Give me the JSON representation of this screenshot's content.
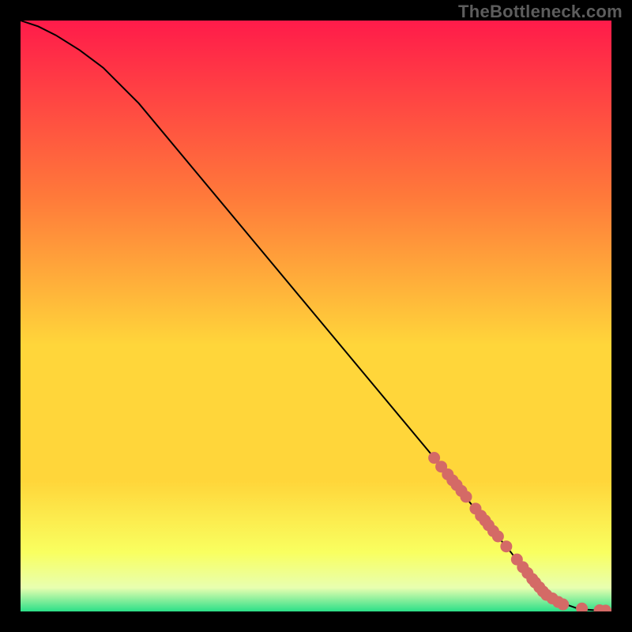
{
  "watermark": "TheBottleneck.com",
  "colors": {
    "bg_black": "#000000",
    "gradient_top": "#ff1b4a",
    "gradient_mid_upper": "#ff7a3a",
    "gradient_mid": "#ffd63a",
    "gradient_mid_lower": "#f9ff60",
    "gradient_low": "#e8ffb0",
    "gradient_bottom": "#2bdf88",
    "curve": "#000000",
    "marker": "#d46a66",
    "watermark": "#5d5d5d"
  },
  "chart_data": {
    "type": "line",
    "title": "",
    "xlabel": "",
    "ylabel": "",
    "xlim": [
      0,
      100
    ],
    "ylim": [
      0,
      100
    ],
    "series": [
      {
        "name": "bottleneck-curve",
        "x": [
          0,
          3,
          6,
          10,
          14,
          20,
          30,
          40,
          50,
          60,
          70,
          78,
          83,
          86,
          88,
          90,
          92,
          94,
          96,
          98,
          100
        ],
        "y": [
          100,
          99,
          97.5,
          95,
          92,
          86,
          74,
          62,
          50,
          38,
          26,
          16,
          10,
          6,
          4,
          2.5,
          1.3,
          0.6,
          0.3,
          0.15,
          0.1
        ]
      }
    ],
    "markers": {
      "name": "highlighted-points",
      "x": [
        70,
        71.2,
        72.3,
        73.1,
        73.8,
        74.6,
        75.4,
        77.0,
        77.9,
        78.6,
        79.2,
        80.0,
        80.8,
        82.2,
        84.0,
        85.0,
        85.8,
        86.6,
        87.1,
        87.8,
        88.4,
        89.0,
        90.0,
        91.0,
        91.8,
        95.0,
        98.0,
        99.0
      ],
      "y": [
        26.0,
        24.5,
        23.2,
        22.2,
        21.4,
        20.4,
        19.4,
        17.4,
        16.2,
        15.4,
        14.6,
        13.6,
        12.7,
        11.0,
        8.8,
        7.5,
        6.5,
        5.5,
        4.9,
        4.1,
        3.4,
        2.8,
        2.2,
        1.6,
        1.2,
        0.5,
        0.2,
        0.15
      ]
    }
  }
}
